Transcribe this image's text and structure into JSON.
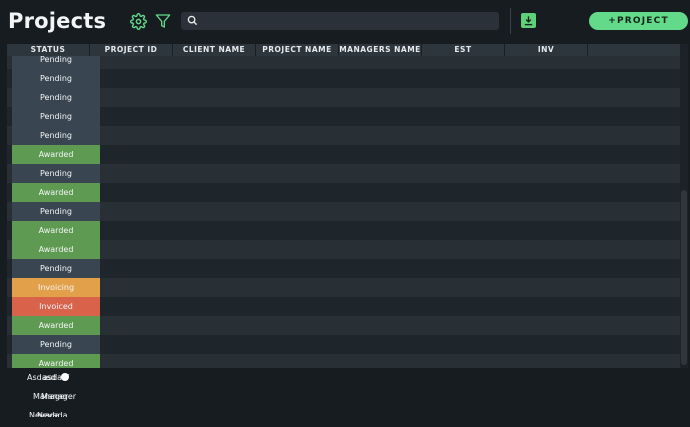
{
  "header": {
    "title": "Projects",
    "search_placeholder": "",
    "add_button_label": "+PROJECT"
  },
  "table": {
    "columns": [
      {
        "label": "STATUS"
      },
      {
        "label": "PROJECT ID"
      },
      {
        "label": "CLIENT NAME"
      },
      {
        "label": "PROJECT NAME"
      },
      {
        "label": "MANAGERS NAME"
      },
      {
        "label": "EST"
      },
      {
        "label": "INV"
      }
    ],
    "rows": [
      {
        "status": "Pending",
        "kind": "pending"
      },
      {
        "status": "Pending",
        "kind": "pending"
      },
      {
        "status": "Pending",
        "kind": "pending"
      },
      {
        "status": "Pending",
        "kind": "pending"
      },
      {
        "status": "Pending",
        "kind": "pending"
      },
      {
        "status": "Awarded",
        "kind": "awarded"
      },
      {
        "status": "Pending",
        "kind": "pending"
      },
      {
        "status": "Awarded",
        "kind": "awarded"
      },
      {
        "status": "Pending",
        "kind": "pending"
      },
      {
        "status": "Awarded",
        "kind": "awarded"
      },
      {
        "status": "Awarded",
        "kind": "awarded"
      },
      {
        "status": "Pending",
        "kind": "pending"
      },
      {
        "status": "Invoicing",
        "kind": "invoicing"
      },
      {
        "status": "Invoiced",
        "kind": "invoiced"
      },
      {
        "status": "Awarded",
        "kind": "awarded"
      },
      {
        "status": "Pending",
        "kind": "pending"
      },
      {
        "status": "Awarded",
        "kind": "awarded"
      }
    ]
  },
  "footer_overlay": {
    "line1": [
      "Asdasd",
      "asdasf"
    ],
    "line2": [
      "Manager",
      "Manager"
    ],
    "line3": [
      "Nevada",
      "Nevada"
    ]
  },
  "colors": {
    "accent": "#63d98a",
    "pending": "#394550",
    "awarded": "#5e9a52",
    "invoicing": "#e3a04a",
    "invoiced": "#d9624a"
  },
  "icons": {
    "settings": "gear-icon",
    "filter": "filter-icon",
    "search": "search-icon",
    "download": "download-icon"
  }
}
